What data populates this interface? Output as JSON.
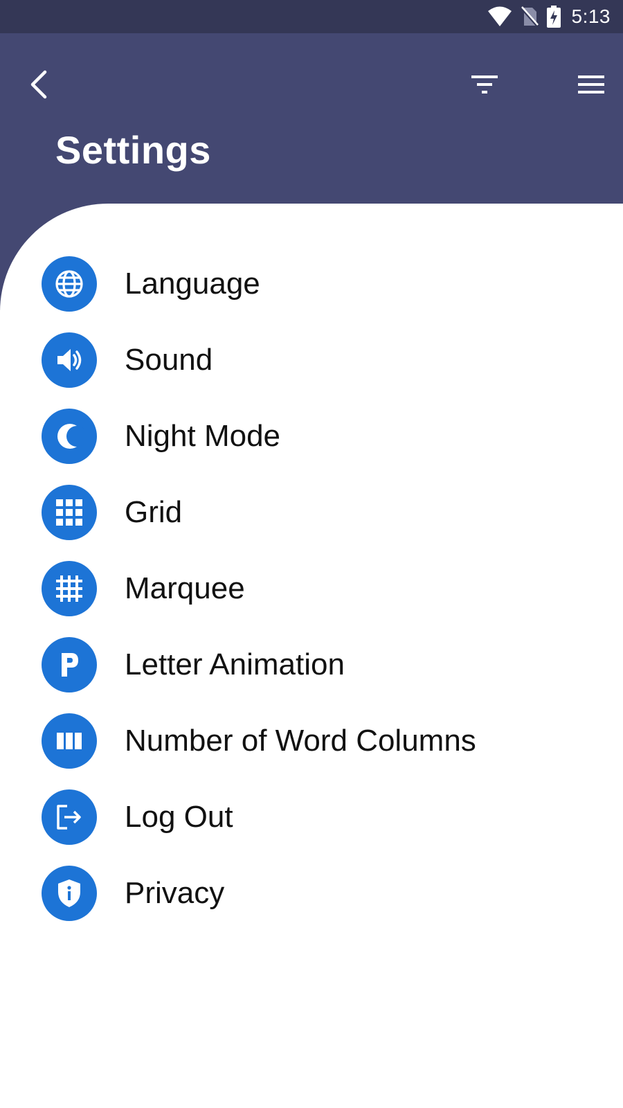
{
  "status_bar": {
    "time": "5:13",
    "icons": [
      "wifi-icon",
      "no-sim-icon",
      "battery-charging-icon"
    ]
  },
  "header": {
    "title": "Settings",
    "back_icon": "chevron-left-icon",
    "filter_icon": "filter-icon",
    "menu_icon": "hamburger-menu-icon"
  },
  "settings": {
    "items": [
      {
        "label": "Language",
        "icon": "globe-icon"
      },
      {
        "label": "Sound",
        "icon": "volume-icon"
      },
      {
        "label": "Night Mode",
        "icon": "moon-icon"
      },
      {
        "label": "Grid",
        "icon": "grid-icon"
      },
      {
        "label": "Marquee",
        "icon": "hashtag-grid-icon"
      },
      {
        "label": "Letter Animation",
        "icon": "letter-p-icon"
      },
      {
        "label": "Number of Word Columns",
        "icon": "columns-icon"
      },
      {
        "label": "Log Out",
        "icon": "logout-icon"
      },
      {
        "label": "Privacy",
        "icon": "shield-info-icon"
      }
    ]
  },
  "colors": {
    "status_bar": "#343756",
    "header": "#444872",
    "icon_circle": "#1d74d6",
    "text": "#111111"
  }
}
